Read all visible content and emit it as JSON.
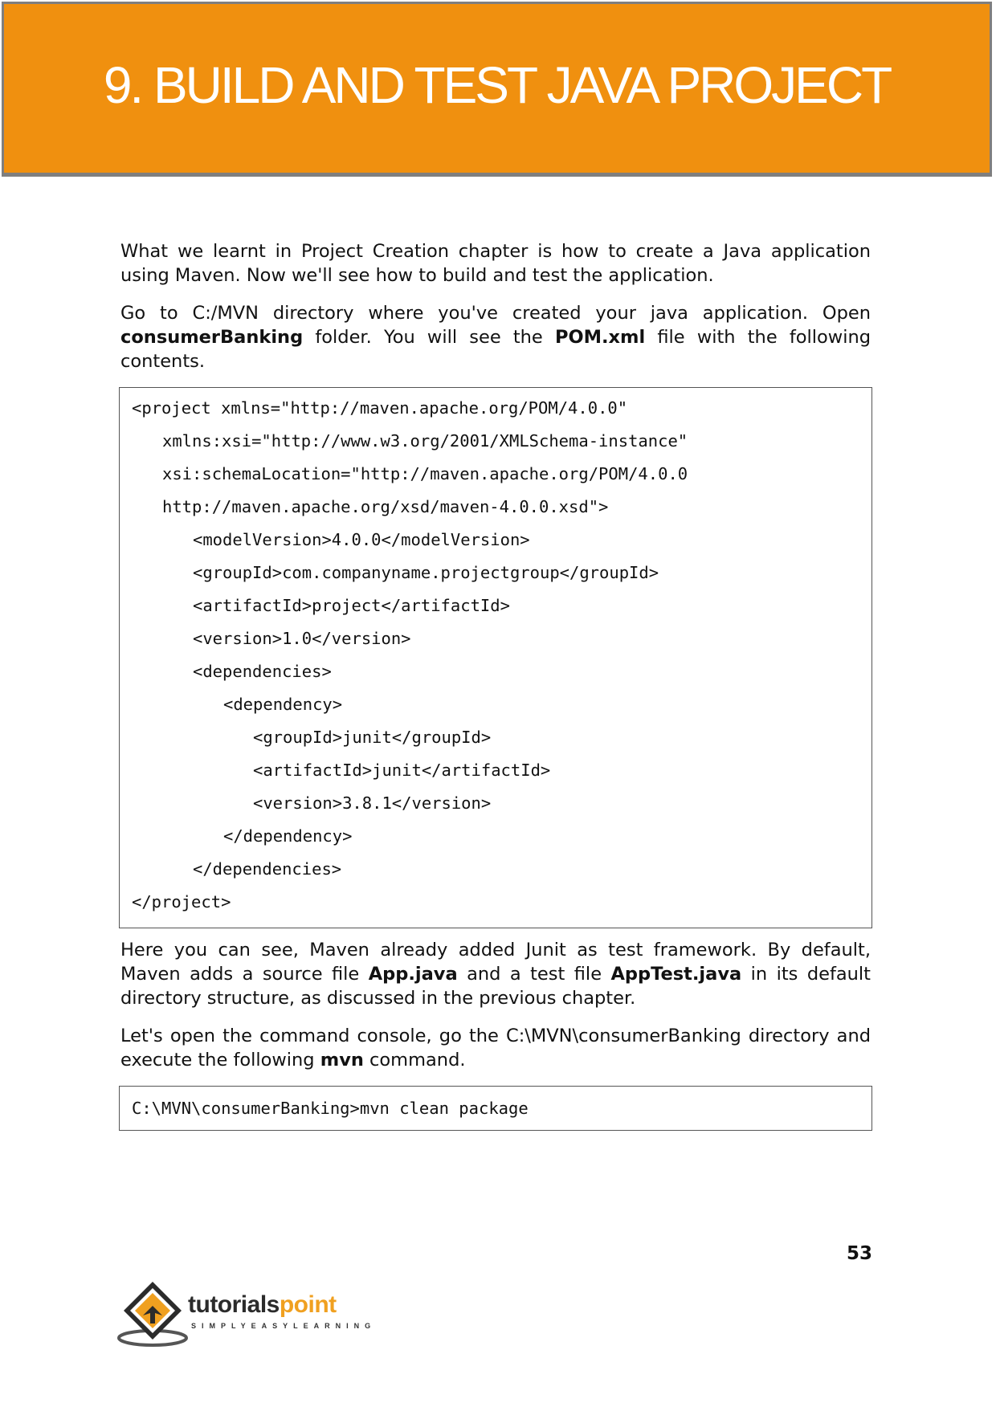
{
  "header": {
    "title": "9.  BUILD AND TEST JAVA PROJECT"
  },
  "intro": {
    "p1": "What we learnt in Project Creation chapter is how to create a Java application using Maven. Now we'll see how to build and test the application.",
    "p2_a": "Go to C:/MVN directory where you've created your java application. Open ",
    "p2_b": "consumerBanking",
    "p2_c": " folder. You will see the ",
    "p2_d": "POM.xml",
    "p2_e": " file with the following contents."
  },
  "pom_code": {
    "lines": [
      "<project xmlns=\"http://maven.apache.org/POM/4.0.0\"",
      "xmlns:xsi=\"http://www.w3.org/2001/XMLSchema-instance\"",
      "xsi:schemaLocation=\"http://maven.apache.org/POM/4.0.0",
      "http://maven.apache.org/xsd/maven-4.0.0.xsd\">",
      "<modelVersion>4.0.0</modelVersion>",
      "<groupId>com.companyname.projectgroup</groupId>",
      "<artifactId>project</artifactId>",
      "<version>1.0</version>",
      "<dependencies>",
      "<dependency>",
      "<groupId>junit</groupId>",
      "<artifactId>junit</artifactId>",
      "<version>3.8.1</version>",
      "</dependency>",
      "</dependencies>",
      "</project>"
    ]
  },
  "middle": {
    "p3_a": "Here you can see, Maven already added Junit as test framework. By default, Maven adds a source file ",
    "p3_b": "App.java",
    "p3_c": " and a test file ",
    "p3_d": "AppTest.java",
    "p3_e": " in its default directory structure, as discussed in the previous chapter.",
    "p4_a": "Let's open the command console, go the C:\\MVN\\consumerBanking directory and execute the following ",
    "p4_b": "mvn",
    "p4_c": " command."
  },
  "command_code": {
    "line": "C:\\MVN\\consumerBanking>mvn clean package"
  },
  "footer": {
    "page_number": "53",
    "logo_word_1": "tutorials",
    "logo_word_2": "point",
    "logo_tagline": "SIMPLYEASYLEARNING"
  }
}
